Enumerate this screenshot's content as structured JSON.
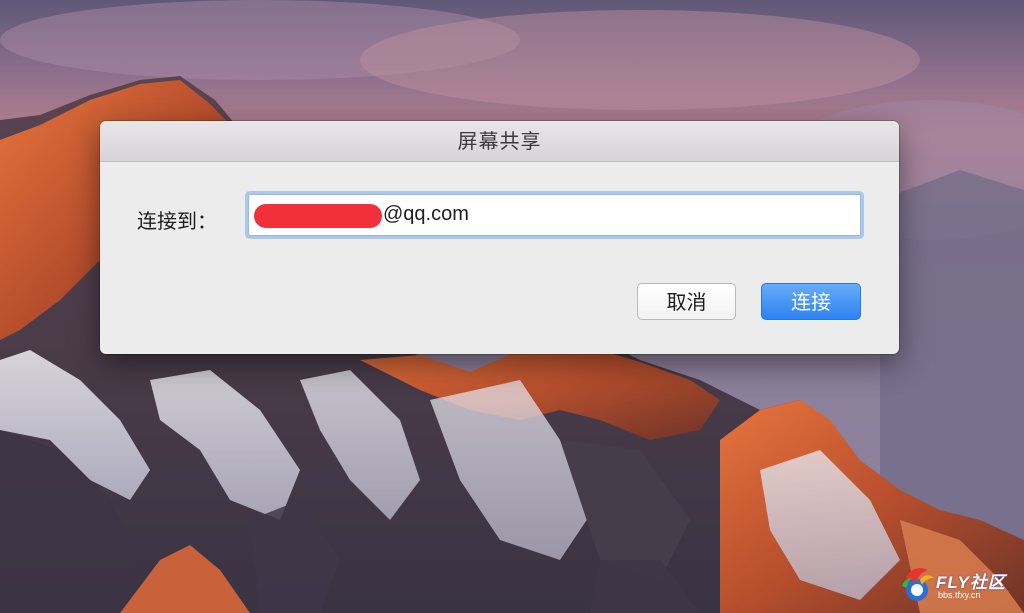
{
  "dialog": {
    "title": "屏幕共享",
    "connect_label": "连接到：",
    "address_suffix": "@qq.com",
    "cancel_label": "取消",
    "connect_button_label": "连接"
  },
  "watermark": {
    "brand": "FLY社区",
    "url": "bbs.tfxy.cn"
  },
  "colors": {
    "dialog_bg": "#ececec",
    "primary_button": "#2d83f2",
    "redaction": "#f1303c",
    "focus_ring": "#a9c8ee"
  },
  "icons": [
    "fly-logo-icon"
  ]
}
